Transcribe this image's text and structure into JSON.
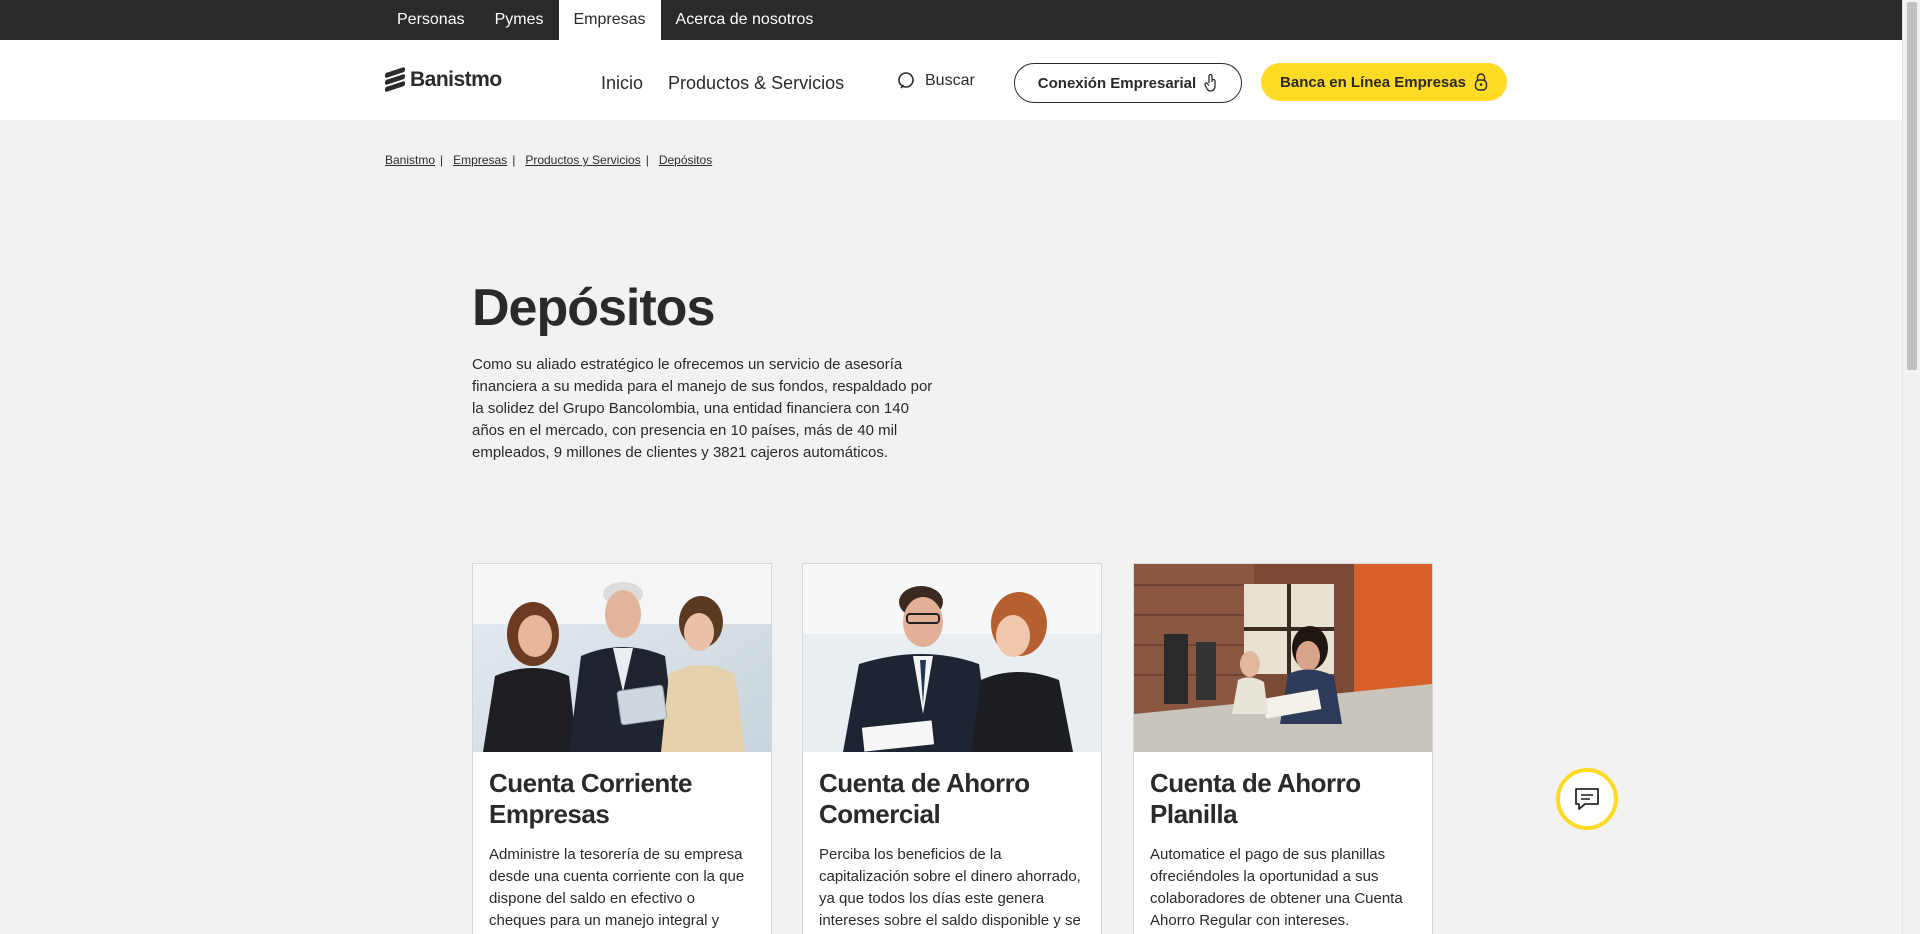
{
  "segments": [
    {
      "label": "Personas"
    },
    {
      "label": "Pymes"
    },
    {
      "label": "Empresas"
    },
    {
      "label": "Acerca de nosotros"
    }
  ],
  "header": {
    "brand": "Banistmo",
    "nav": [
      {
        "label": "Inicio"
      },
      {
        "label": "Productos & Servicios"
      }
    ],
    "search_label": "Buscar",
    "btn_conexion": "Conexión Empresarial",
    "btn_banca": "Banca en Línea Empresas"
  },
  "breadcrumb": [
    {
      "label": "Banistmo"
    },
    {
      "label": "Empresas"
    },
    {
      "label": "Productos y Servicios"
    },
    {
      "label": "Depósitos"
    }
  ],
  "hero": {
    "title": "Depósitos",
    "lead": "Como su aliado estratégico le ofrecemos un servicio de asesoría financiera a su medida para el manejo de sus fondos, respaldado por la solidez del Grupo Bancolombia, una entidad financiera con 140 años en el mercado, con presencia en 10 países, más de 40 mil empleados, 9 millones de clientes y 3821 cajeros automáticos."
  },
  "cards": [
    {
      "title": "Cuenta Corriente Empresas",
      "text": "Administre la tesorería de su empresa desde una cuenta corriente con la que dispone del saldo en efectivo o cheques para un manejo integral y seguro de su"
    },
    {
      "title": "Cuenta de Ahorro Comercial",
      "text": "Perciba los beneficios de la capitalización sobre el dinero ahorrado, ya que todos los días este genera intereses sobre el saldo disponible y se"
    },
    {
      "title": "Cuenta de Ahorro Planilla",
      "text": "Automatice el pago de sus planillas ofreciéndoles la oportunidad a sus colaboradores de obtener una Cuenta Ahorro Regular con intereses."
    }
  ],
  "colors": {
    "brand_yellow": "#fdda24",
    "dark": "#2c2a29",
    "background": "#f2f2f2"
  },
  "icons": [
    "search-icon",
    "touch-icon",
    "lock-icon",
    "chat-icon"
  ]
}
